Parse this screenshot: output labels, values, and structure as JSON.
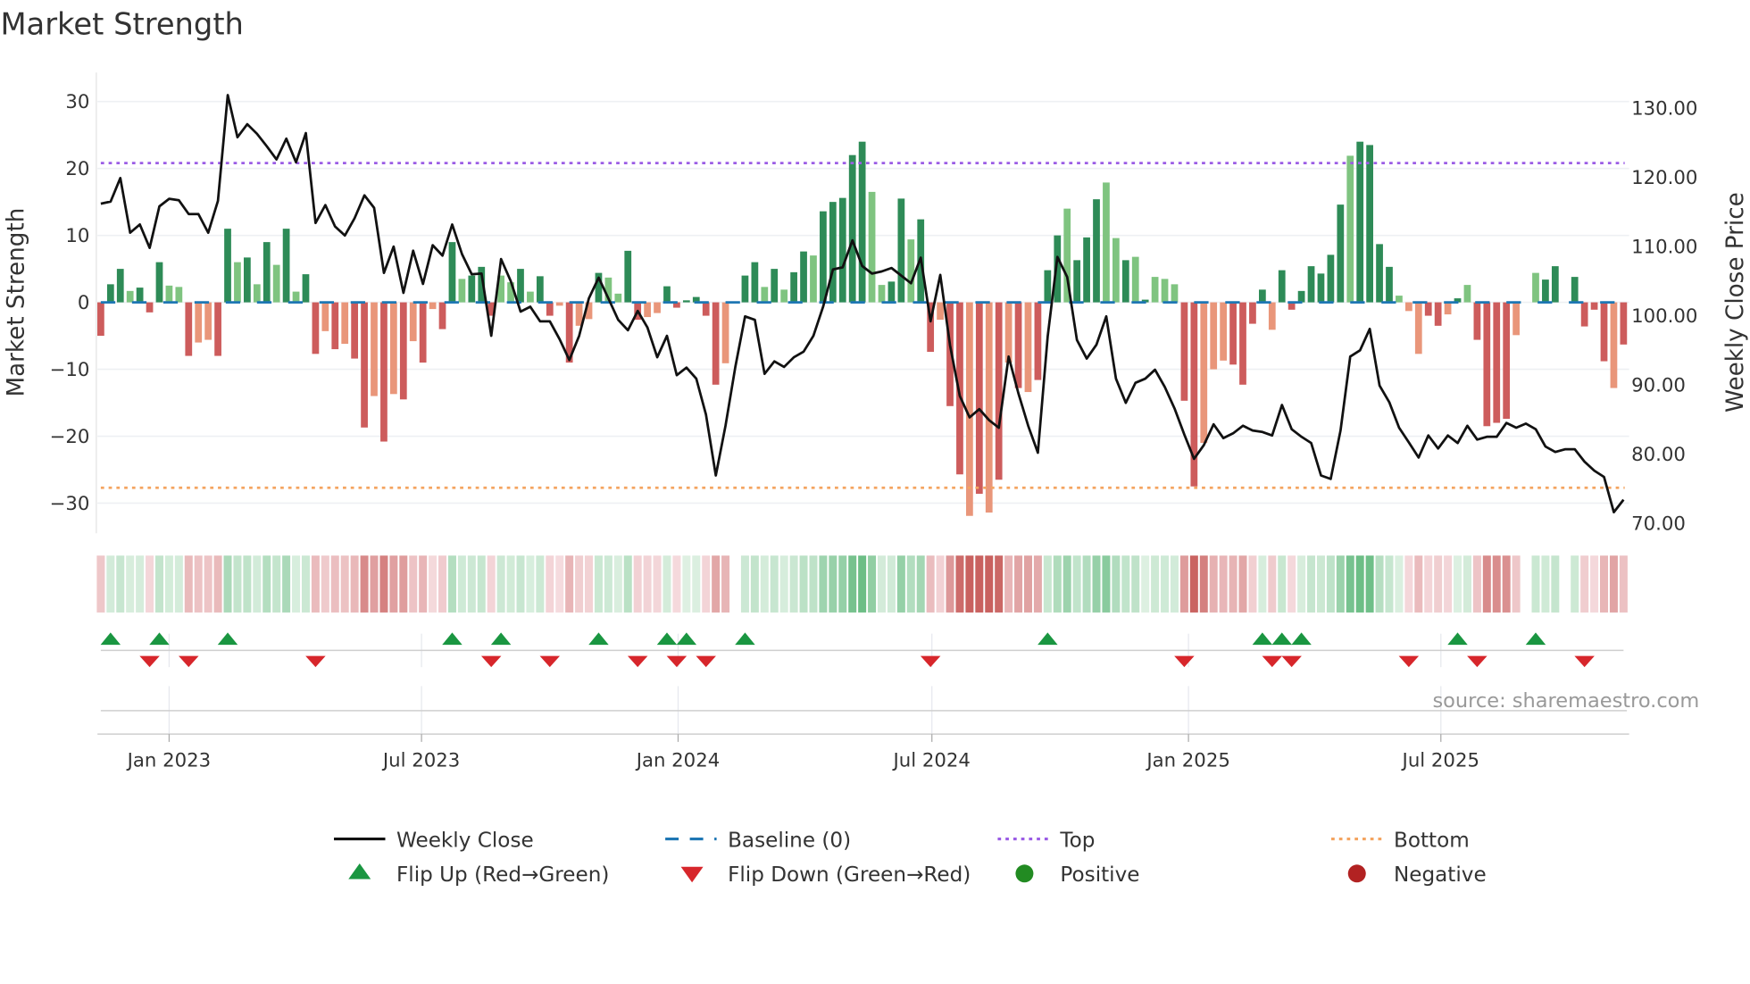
{
  "chart_data": {
    "type": "bar",
    "title": "Market Strength",
    "ylabel": "Market Strength",
    "y2label": "Weekly Close Price",
    "ylim": [
      -34,
      34
    ],
    "y2lim": [
      67,
      135
    ],
    "yticks": [
      30,
      20,
      10,
      0,
      -10,
      -20,
      -30
    ],
    "y2ticks": [
      "130.00",
      "120.00",
      "110.00",
      "100.00",
      "90.00",
      "80.00",
      "70.00"
    ],
    "first_week": "2022-11-13",
    "xticks": [
      {
        "label": "Jan 2023",
        "date": "2023-01-01"
      },
      {
        "label": "Jul 2023",
        "date": "2023-07-01"
      },
      {
        "label": "Jan 2024",
        "date": "2024-01-01"
      },
      {
        "label": "Jul 2024",
        "date": "2024-07-01"
      },
      {
        "label": "Jan 2025",
        "date": "2025-01-01"
      },
      {
        "label": "Jul 2025",
        "date": "2025-07-01"
      }
    ],
    "top_level": 20.8,
    "bottom_level": -27.7,
    "baseline": 0,
    "strength": [
      -5,
      2.7,
      5,
      1.7,
      2.2,
      -1.5,
      6,
      2.5,
      2.3,
      -8,
      -6,
      -5.6,
      -8,
      11,
      6,
      6.7,
      2.7,
      9,
      5.6,
      11,
      1.6,
      4.2,
      -7.7,
      -4.3,
      -7,
      -6.2,
      -8.4,
      -18.7,
      -14,
      -20.8,
      -13.7,
      -14.5,
      -5.8,
      -9,
      -1,
      -4,
      9,
      3.5,
      4,
      5.3,
      -2,
      4,
      3,
      5,
      1.6,
      3.9,
      -2,
      -0.5,
      -9,
      -3.5,
      -2.5,
      4.4,
      3.7,
      1.3,
      7.7,
      -2.6,
      -2.2,
      -1.6,
      2.4,
      -0.8,
      0.3,
      0.8,
      -2,
      -12.3,
      -9.1,
      0,
      4,
      6,
      2.3,
      5,
      1.9,
      4.5,
      7.6,
      7,
      13.6,
      15,
      15.6,
      22,
      24,
      16.5,
      2.6,
      3.1,
      15.5,
      9.4,
      12.4,
      -7.4,
      -2.6,
      -15.5,
      -25.7,
      -31.9,
      -28.6,
      -31.4,
      -26.5,
      -9,
      -12.8,
      -13.4,
      -11.6,
      4.8,
      10,
      14,
      6.3,
      9.7,
      15.4,
      17.9,
      9.6,
      6.3,
      6.8,
      0.4,
      3.8,
      3.5,
      2.7,
      -14.7,
      -27.5,
      -21,
      -10,
      -8.7,
      -9.3,
      -12.3,
      -3.2,
      1.9,
      -4.1,
      4.8,
      -1.1,
      1.7,
      5.4,
      4.3,
      7.1,
      14.6,
      21.9,
      24,
      23.5,
      8.7,
      5.3,
      1,
      -1.3,
      -7.7,
      -2,
      -3.5,
      -1.8,
      0.6,
      2.6,
      -5.6,
      -18.5,
      -18,
      -17.4,
      -4.9,
      0,
      4.4,
      3.4,
      5.4,
      0,
      3.8,
      -3.6,
      -1.1,
      -8.8,
      -12.8,
      -6.3
    ],
    "fading": "DDDLDDDLLDLLDDLDLDLDLDDLDLDDLDLDLDLDDLDDDLLDLDDLDLLDLLDDLLDDDDDDLDDDLDLDDLDDDDDLLDDLDDLDDLDLDLDLDDDLDDDLLDLDLLLDDLLLDDDDLDDDDDDDLDDDDLLLDDLDLDDDDLLLDDLDDDDLDDL",
    "close": [
      116.2,
      116.5,
      119.9,
      112.0,
      113.2,
      109.8,
      115.8,
      116.9,
      116.7,
      114.7,
      114.7,
      112.0,
      116.6,
      131.9,
      125.8,
      127.7,
      126.3,
      124.5,
      122.6,
      125.6,
      122.2,
      126.4,
      113.4,
      116.0,
      112.9,
      111.6,
      114.1,
      117.4,
      115.6,
      106.2,
      110.0,
      103.3,
      109.4,
      104.6,
      110.2,
      108.7,
      113.2,
      108.9,
      106.0,
      106.1,
      97.1,
      108.2,
      105.0,
      100.6,
      101.3,
      99.2,
      99.2,
      96.6,
      93.6,
      97.1,
      102.5,
      105.5,
      102.5,
      99.4,
      97.9,
      100.7,
      98.3,
      94.0,
      97.1,
      91.4,
      92.5,
      90.9,
      85.7,
      76.9,
      84.1,
      92.6,
      99.9,
      99.4,
      91.6,
      93.4,
      92.6,
      94.0,
      94.8,
      97.1,
      101.3,
      106.7,
      107.0,
      110.9,
      107.2,
      106.1,
      106.4,
      106.9,
      105.8,
      104.7,
      108.4,
      99.2,
      105.9,
      95.7,
      88.4,
      85.3,
      86.5,
      84.9,
      83.8,
      94.1,
      88.8,
      84.1,
      80.2,
      97.0,
      108.5,
      105.6,
      96.5,
      93.8,
      95.8,
      99.9,
      90.9,
      87.4,
      90.3,
      90.9,
      92.2,
      89.7,
      86.6,
      82.8,
      79.3,
      81.3,
      84.3,
      82.3,
      83.0,
      84.1,
      83.4,
      83.2,
      82.7,
      87.1,
      83.6,
      82.5,
      81.6,
      76.9,
      76.4,
      83.4,
      94.1,
      95.0,
      98.1,
      89.9,
      87.5,
      83.8,
      81.7,
      79.5,
      82.7,
      80.8,
      82.7,
      81.6,
      84.1,
      82.1,
      82.5,
      82.5,
      84.5,
      83.8,
      84.4,
      83.6,
      81.1,
      80.3,
      80.7,
      80.7,
      78.9,
      77.6,
      76.7,
      71.6,
      73.4
    ],
    "flip_up_weeks": [
      1,
      6,
      13,
      36,
      41,
      51,
      58,
      60,
      66,
      97,
      119,
      121,
      123,
      139,
      147
    ],
    "flip_down_weeks": [
      5,
      9,
      22,
      40,
      46,
      55,
      59,
      62,
      85,
      111,
      120,
      122,
      134,
      141,
      152
    ],
    "legend": {
      "placement": "bottom",
      "weekly_close": "Weekly Close",
      "baseline": "Baseline (0)",
      "top": "Top",
      "bottom": "Bottom",
      "flip_up": "Flip Up (Red→Green)",
      "flip_down": "Flip Down (Green→Red)",
      "positive": "Positive",
      "negative": "Negative"
    },
    "source": "source: sharemaestro.com"
  },
  "colors": {
    "pos_dark": "#2e8b57",
    "pos_light": "#7fc480",
    "neg_dark": "#cd5c5c",
    "neg_light": "#e9967a",
    "close": "#111111",
    "baseline": "#1f77b4",
    "top": "#9b5de5",
    "bottom": "#f4a460",
    "flip_up": "#1a9641",
    "flip_down": "#d7262b",
    "positive": "#228b22",
    "negative": "#b22222"
  }
}
